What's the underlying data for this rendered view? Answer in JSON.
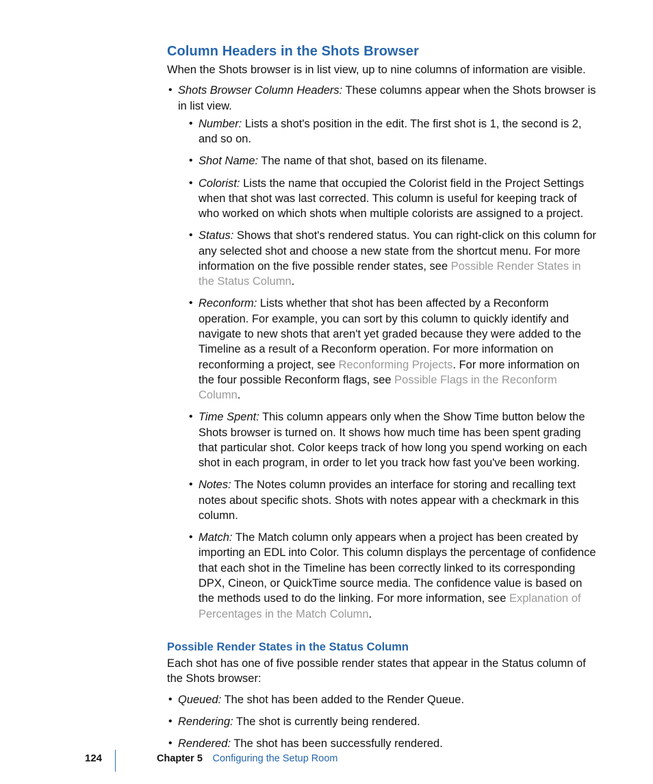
{
  "section": {
    "heading": "Column Headers in the Shots Browser",
    "intro": "When the Shots browser is in list view, up to nine columns of information are visible."
  },
  "top_item": {
    "term": "Shots Browser Column Headers:",
    "text": "  These columns appear when the Shots browser is in list view."
  },
  "columns": [
    {
      "term": "Number:",
      "text": "  Lists a shot's position in the edit. The first shot is 1, the second is 2, and so on."
    },
    {
      "term": "Shot Name:",
      "text": "  The name of that shot, based on its filename."
    },
    {
      "term": "Colorist:",
      "text": "  Lists the name that occupied the Colorist field in the Project Settings when that shot was last corrected. This column is useful for keeping track of who worked on which shots when multiple colorists are assigned to a project."
    },
    {
      "term": "Status:",
      "text_a": "  Shows that shot's rendered status. You can right-click on this column for any selected shot and choose a new state from the shortcut menu. For more information on the five possible render states, see ",
      "link_a": "Possible Render States in the Status Column",
      "text_b": "."
    },
    {
      "term": "Reconform:",
      "text_a": "  Lists whether that shot has been affected by a Reconform operation. For example, you can sort by this column to quickly identify and navigate to new shots that aren't yet graded because they were added to the Timeline as a result of a Reconform operation. For more information on reconforming a project, see ",
      "link_a": "Reconforming Projects",
      "text_b": ". For more information on the four possible Reconform flags, see ",
      "link_b": "Possible Flags in the Reconform Column",
      "text_c": "."
    },
    {
      "term": "Time Spent:",
      "text": "  This column appears only when the Show Time button below the Shots browser is turned on. It shows how much time has been spent grading that particular shot. Color keeps track of how long you spend working on each shot in each program, in order to let you track how fast you've been working."
    },
    {
      "term": "Notes:",
      "text": "  The Notes column provides an interface for storing and recalling text notes about specific shots. Shots with notes appear with a checkmark in this column."
    },
    {
      "term": "Match:",
      "text_a": "  The Match column only appears when a project has been created by importing an EDL into Color. This column displays the percentage of confidence that each shot in the Timeline has been correctly linked to its corresponding DPX, Cineon, or QuickTime source media. The confidence value is based on the methods used to do the linking. For more information, see ",
      "link_a": "Explanation of Percentages in the Match Column",
      "text_b": "."
    }
  ],
  "subsection": {
    "heading": "Possible Render States in the Status Column",
    "intro": "Each shot has one of five possible render states that appear in the Status column of the Shots browser:"
  },
  "states": [
    {
      "term": "Queued:",
      "text": "  The shot has been added to the Render Queue."
    },
    {
      "term": "Rendering:",
      "text": "  The shot is currently being rendered."
    },
    {
      "term": "Rendered:",
      "text": "  The shot has been successfully rendered."
    }
  ],
  "footer": {
    "page_number": "124",
    "chapter_label": "Chapter 5",
    "chapter_title": "Configuring the Setup Room"
  }
}
